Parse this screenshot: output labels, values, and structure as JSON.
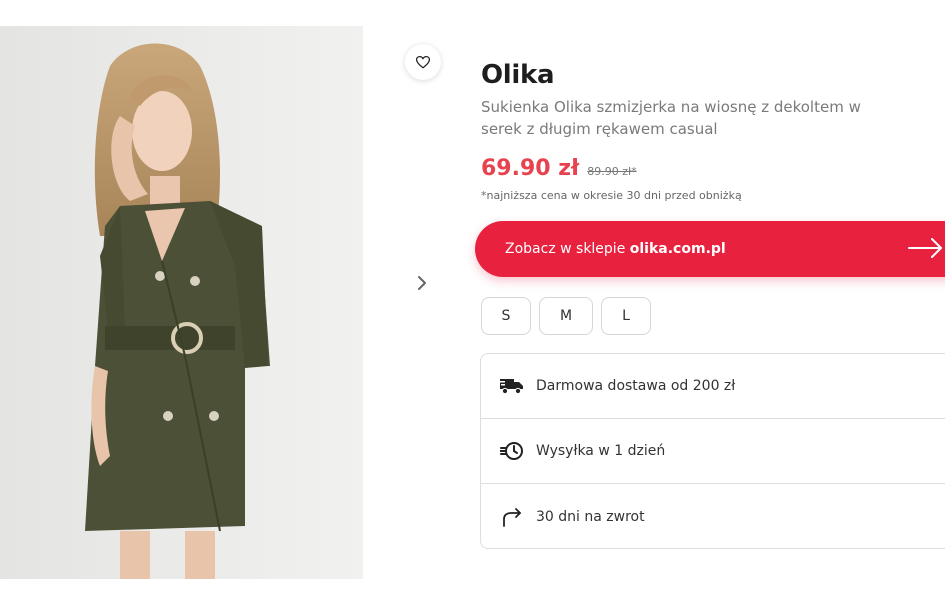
{
  "product": {
    "brand": "Olika",
    "description": "Sukienka Olika szmizjerka na wiosnę z dekoltem w serek z długim rękawem casual",
    "price": "69.90 zł",
    "old_price": "89.90 zł*",
    "lowest_price_note": "*najniższa cena w okresie 30 dni przed obniżką"
  },
  "shop_button": {
    "prefix": "Zobacz w sklepie ",
    "shop": "olika.com.pl",
    "icon": "arrow-right-icon"
  },
  "sizes": [
    "S",
    "M",
    "L"
  ],
  "info": [
    {
      "icon": "truck-icon",
      "text": "Darmowa dostawa od 200 zł"
    },
    {
      "icon": "fast-clock-icon",
      "text": "Wysyłka w 1 dzień"
    },
    {
      "icon": "return-arrow-icon",
      "text": "30 dni na zwrot"
    }
  ],
  "icons": {
    "favorite": "heart-icon",
    "next": "chevron-right-icon"
  },
  "colors": {
    "accent": "#e8213f",
    "price": "#e8424e",
    "dress": "#4c5036"
  }
}
